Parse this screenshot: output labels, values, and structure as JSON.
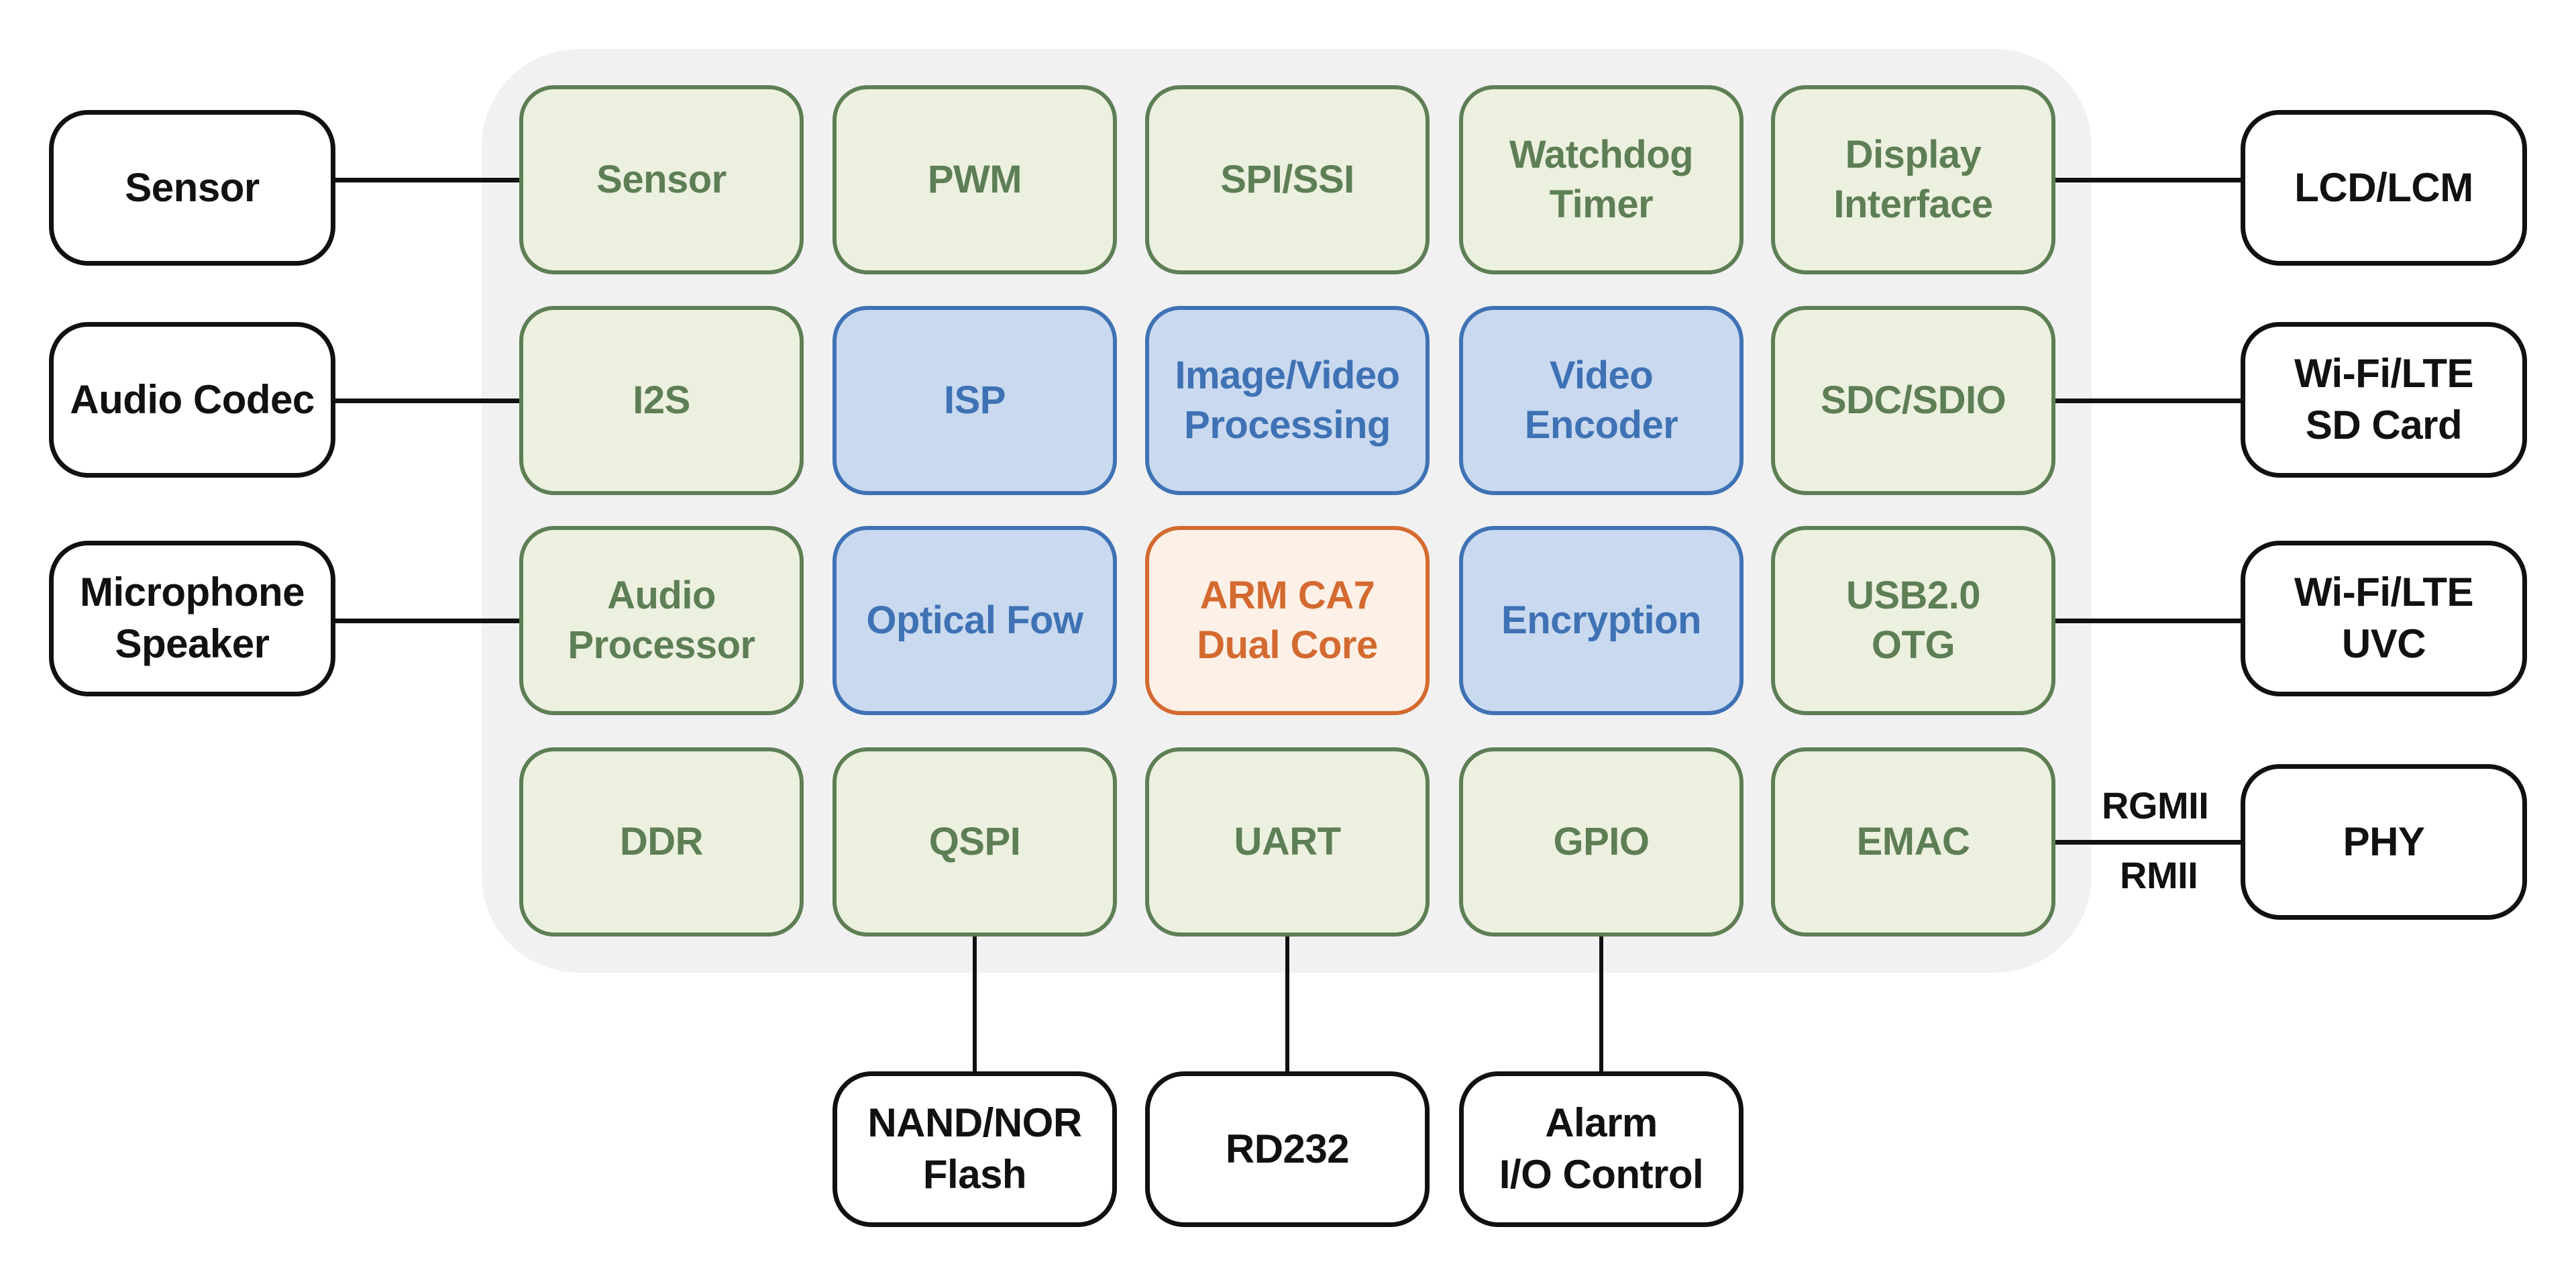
{
  "diagram": {
    "title": "",
    "colors": {
      "container_fill": "#f1f1f1",
      "peripheral_fill": "#ebf0df",
      "peripheral_stroke": "#5e7e55",
      "media_fill": "#c9d9ef",
      "media_stroke": "#3f72b4",
      "cpu_fill": "#fdf0e6",
      "cpu_stroke": "#d46a30",
      "external_fill": "#ffffff",
      "external_stroke": "#111111"
    },
    "soc_blocks": [
      {
        "id": "sensor-if",
        "label": "Sensor",
        "kind": "peripheral",
        "row": 0,
        "col": 0
      },
      {
        "id": "pwm",
        "label": "PWM",
        "kind": "peripheral",
        "row": 0,
        "col": 1
      },
      {
        "id": "spi-ssi",
        "label": "SPI/SSI",
        "kind": "peripheral",
        "row": 0,
        "col": 2
      },
      {
        "id": "watchdog-timer",
        "label": "Watchdog\nTimer",
        "kind": "peripheral",
        "row": 0,
        "col": 3
      },
      {
        "id": "display-interface",
        "label": "Display\nInterface",
        "kind": "peripheral",
        "row": 0,
        "col": 4
      },
      {
        "id": "i2s",
        "label": "I2S",
        "kind": "peripheral",
        "row": 1,
        "col": 0
      },
      {
        "id": "isp",
        "label": "ISP",
        "kind": "media",
        "row": 1,
        "col": 1
      },
      {
        "id": "image-video-processing",
        "label": "Image/Video\nProcessing",
        "kind": "media",
        "row": 1,
        "col": 2
      },
      {
        "id": "video-encoder",
        "label": "Video\nEncoder",
        "kind": "media",
        "row": 1,
        "col": 3
      },
      {
        "id": "sdc-sdio",
        "label": "SDC/SDIO",
        "kind": "peripheral",
        "row": 1,
        "col": 4
      },
      {
        "id": "audio-processor",
        "label": "Audio\nProcessor",
        "kind": "peripheral",
        "row": 2,
        "col": 0
      },
      {
        "id": "optical-flow",
        "label": "Optical Fow",
        "kind": "media",
        "row": 2,
        "col": 1
      },
      {
        "id": "arm-ca7",
        "label": "ARM CA7\nDual Core",
        "kind": "cpu",
        "row": 2,
        "col": 2
      },
      {
        "id": "encryption",
        "label": "Encryption",
        "kind": "media",
        "row": 2,
        "col": 3
      },
      {
        "id": "usb-otg",
        "label": "USB2.0\nOTG",
        "kind": "peripheral",
        "row": 2,
        "col": 4
      },
      {
        "id": "ddr",
        "label": "DDR",
        "kind": "peripheral",
        "row": 3,
        "col": 0
      },
      {
        "id": "qspi",
        "label": "QSPI",
        "kind": "peripheral",
        "row": 3,
        "col": 1
      },
      {
        "id": "uart",
        "label": "UART",
        "kind": "peripheral",
        "row": 3,
        "col": 2
      },
      {
        "id": "gpio",
        "label": "GPIO",
        "kind": "peripheral",
        "row": 3,
        "col": 3
      },
      {
        "id": "emac",
        "label": "EMAC",
        "kind": "peripheral",
        "row": 3,
        "col": 4
      }
    ],
    "external_devices": [
      {
        "id": "ext-sensor",
        "label": "Sensor",
        "side": "left",
        "row": 0,
        "connects_to": "sensor-if"
      },
      {
        "id": "ext-audio-codec",
        "label": "Audio Codec",
        "side": "left",
        "row": 1,
        "connects_to": "i2s"
      },
      {
        "id": "ext-mic-speaker",
        "label": "Microphone\nSpeaker",
        "side": "left",
        "row": 2,
        "connects_to": "audio-processor"
      },
      {
        "id": "ext-lcd",
        "label": "LCD/LCM",
        "side": "right",
        "row": 0,
        "connects_to": "display-interface"
      },
      {
        "id": "ext-wifi-sd",
        "label": "Wi-Fi/LTE\nSD Card",
        "side": "right",
        "row": 1,
        "connects_to": "sdc-sdio"
      },
      {
        "id": "ext-wifi-uvc",
        "label": "Wi-Fi/LTE\nUVC",
        "side": "right",
        "row": 2,
        "connects_to": "usb-otg"
      },
      {
        "id": "ext-phy",
        "label": "PHY",
        "side": "right",
        "row": 3,
        "connects_to": "emac"
      },
      {
        "id": "ext-flash",
        "label": "NAND/NOR\nFlash",
        "side": "bottom",
        "col": 1,
        "connects_to": "qspi"
      },
      {
        "id": "ext-rd232",
        "label": "RD232",
        "side": "bottom",
        "col": 2,
        "connects_to": "uart"
      },
      {
        "id": "ext-alarm-io",
        "label": "Alarm\nI/O Control",
        "side": "bottom",
        "col": 3,
        "connects_to": "gpio"
      }
    ],
    "link_labels": {
      "emac_phy_top": "RGMII",
      "emac_phy_bottom": "RMII"
    }
  }
}
